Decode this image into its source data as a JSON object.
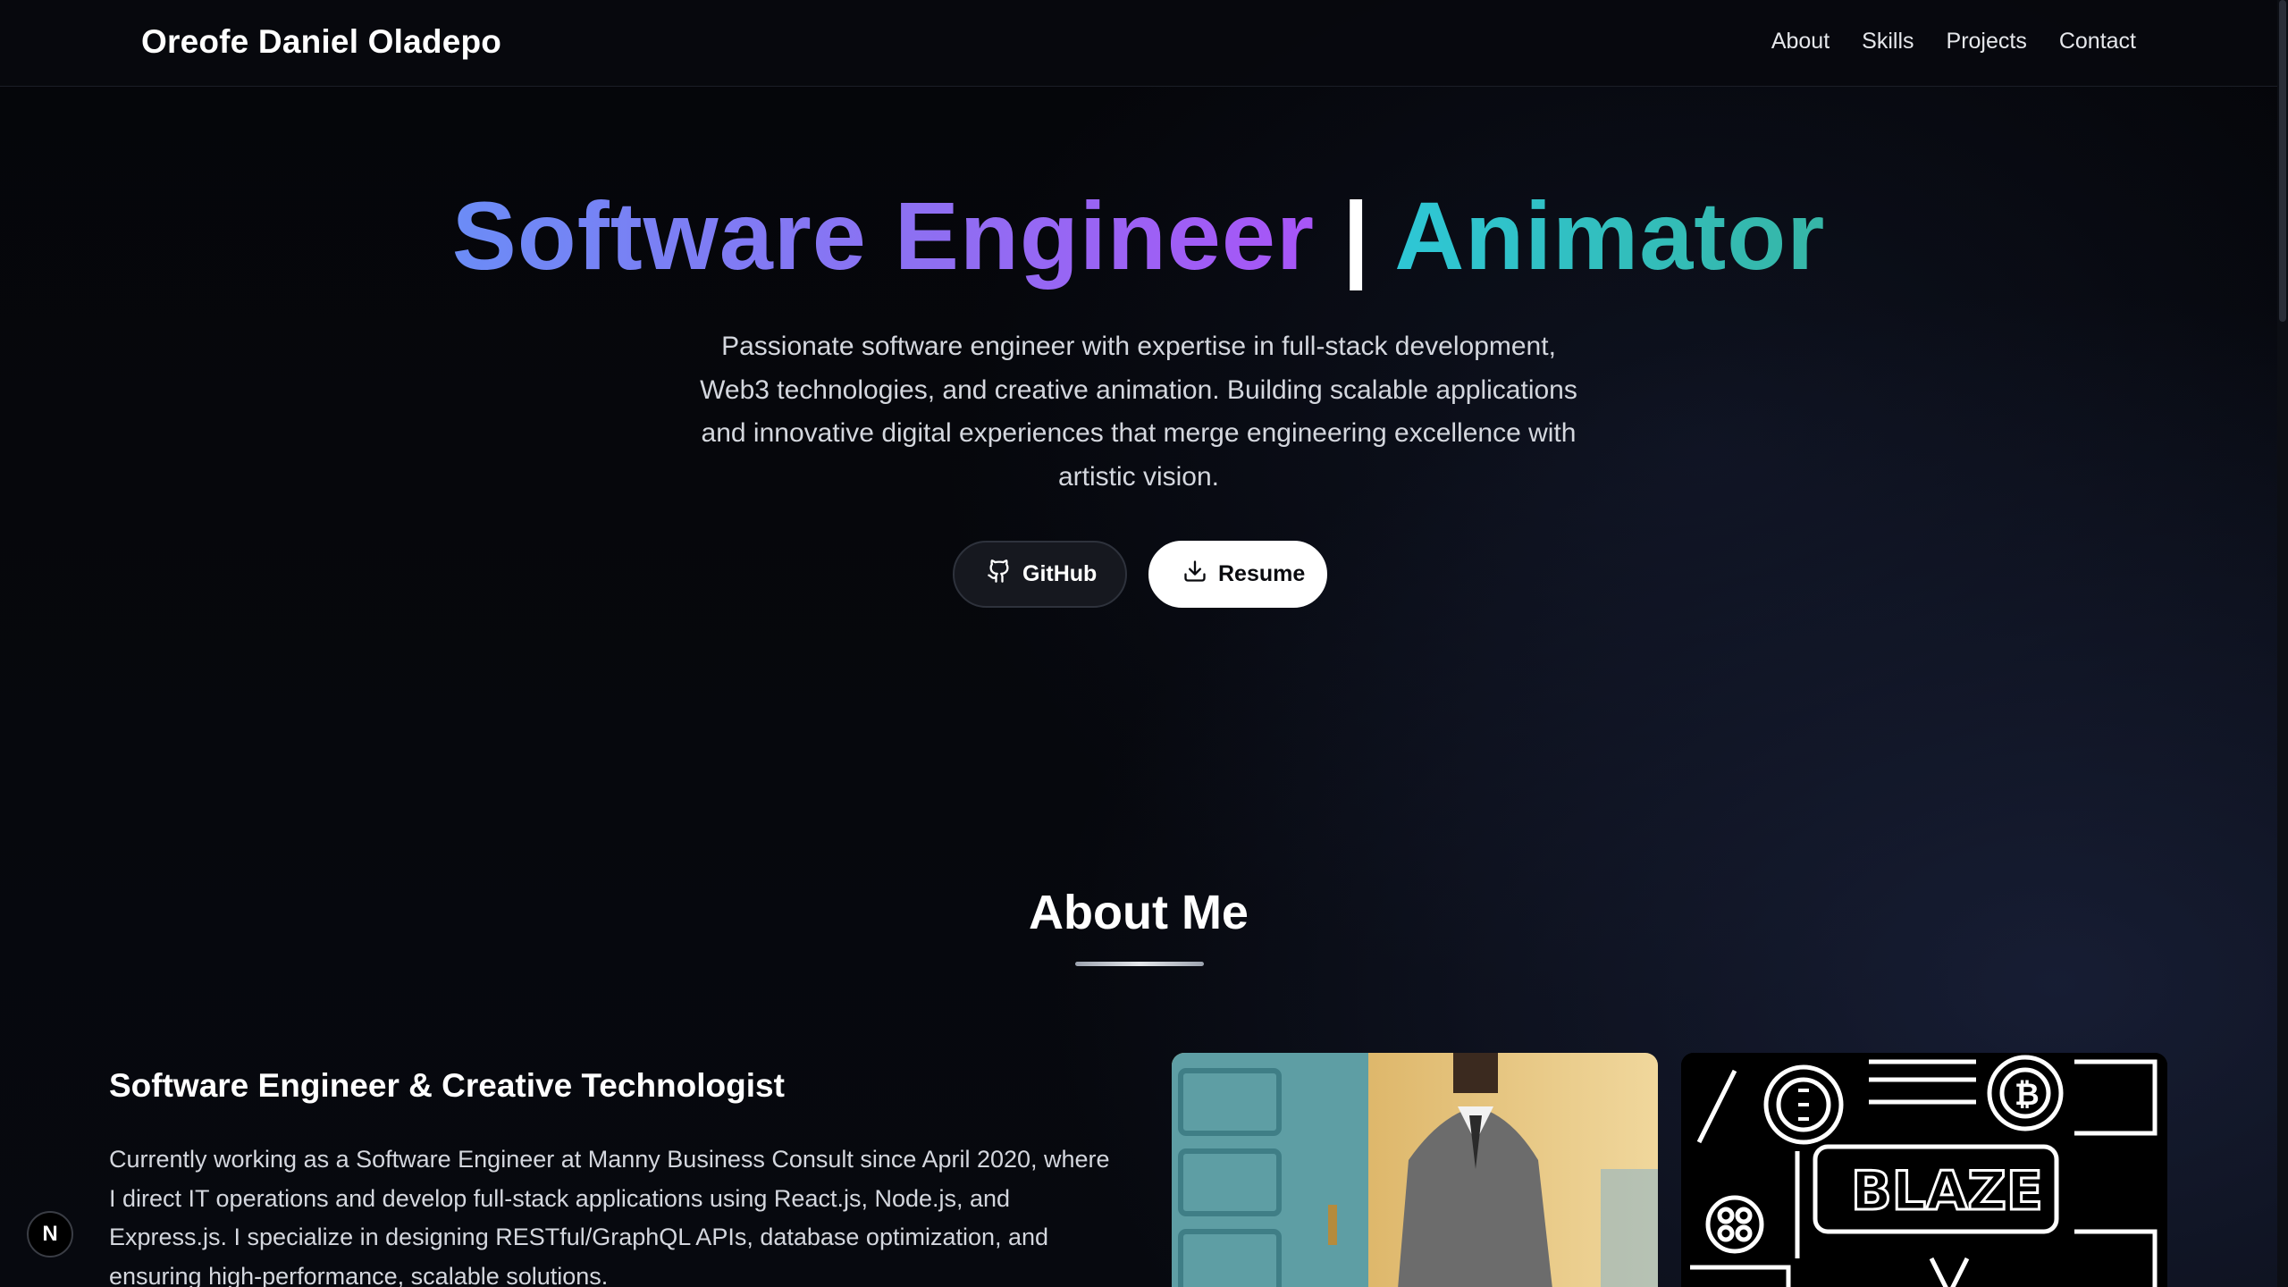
{
  "header": {
    "brand": "Oreofe Daniel Oladepo",
    "nav": [
      "About",
      "Skills",
      "Projects",
      "Contact"
    ]
  },
  "hero": {
    "title_part1": "Software Engineer",
    "title_separator": "|",
    "title_part2": "Animator",
    "description": "Passionate software engineer with expertise in full-stack development, Web3 technologies, and creative animation. Building scalable applications and innovative digital experiences that merge engineering excellence with artistic vision.",
    "buttons": {
      "github": "GitHub",
      "resume": "Resume"
    },
    "colors": {
      "gradient_a_start": "#6b8cf6",
      "gradient_a_end": "#a855f7",
      "gradient_b_start": "#2ec7d6",
      "gradient_b_end": "#36b6a6"
    }
  },
  "about": {
    "title": "About Me",
    "subtitle": "Software Engineer & Creative Technologist",
    "text": "Currently working as a Software Engineer at Manny Business Consult since April 2020, where I direct IT operations and develop full-stack applications using React.js, Node.js, and Express.js. I specialize in designing RESTful/GraphQL APIs, database optimization, and ensuring high-performance, scalable solutions.",
    "images": [
      "profile-photo",
      "crypto-graffiti-art"
    ]
  },
  "floating_badge": "N",
  "icons": [
    "github-icon",
    "download-icon"
  ]
}
